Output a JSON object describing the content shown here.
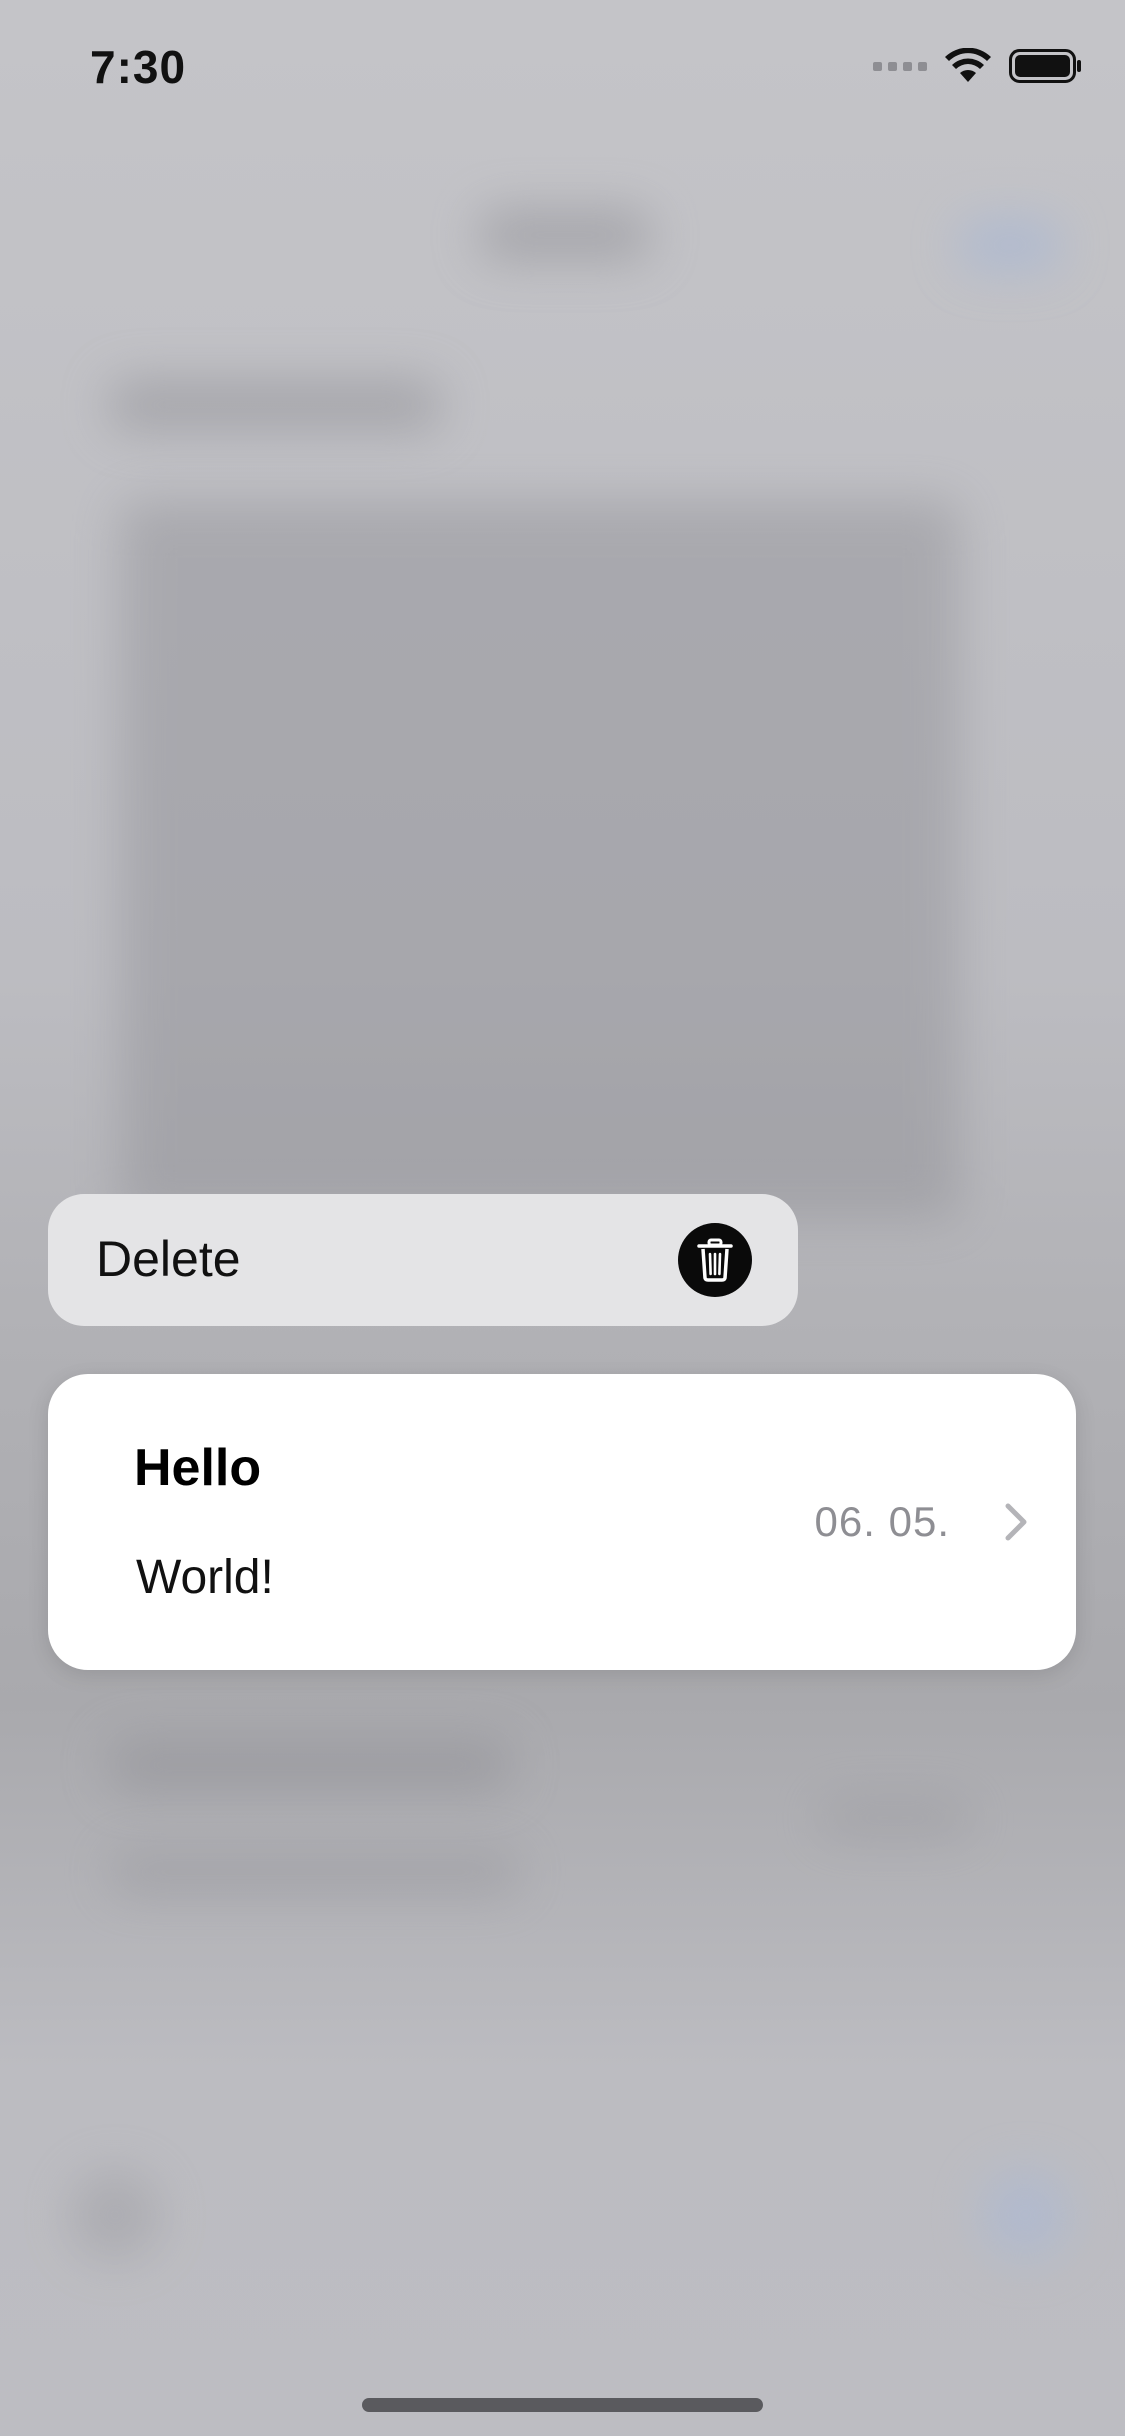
{
  "status_bar": {
    "time": "7:30",
    "icons": [
      "signal-icon",
      "wifi-icon",
      "battery-icon"
    ]
  },
  "context_menu": {
    "actions": [
      {
        "label": "Delete",
        "icon": "trash-icon"
      }
    ]
  },
  "preview": {
    "title": "Hello",
    "body": "World!",
    "date": "06. 05.",
    "accessory_icon": "chevron-right-icon"
  },
  "colors": {
    "menu_background": "#e4e4e6",
    "card_background": "#ffffff",
    "date_text": "#8e8e93",
    "trash_button": "#0a0a0a",
    "dim_background": "#bdbdc2"
  }
}
